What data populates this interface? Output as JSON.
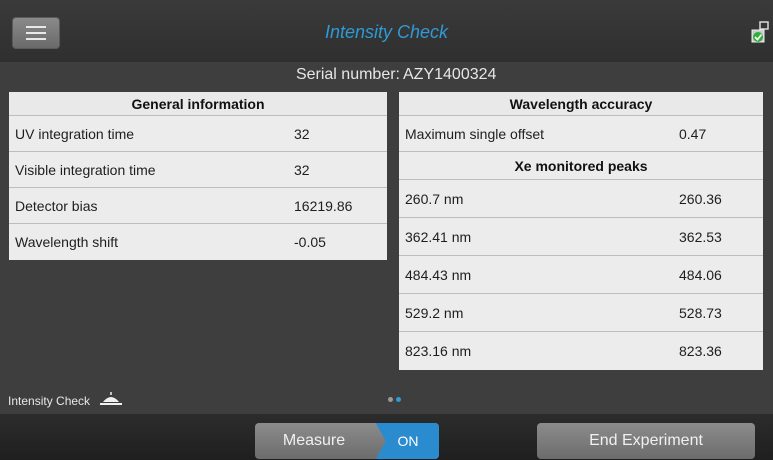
{
  "header": {
    "title": "Intensity Check",
    "menu_icon": "hamburger-menu-icon",
    "status_icon": "instrument-check-icon"
  },
  "serial": {
    "label": "Serial number:",
    "value": "AZY1400324"
  },
  "general_info": {
    "title": "General information",
    "rows": [
      {
        "label": "UV integration time",
        "value": "32"
      },
      {
        "label": "Visible integration time",
        "value": "32"
      },
      {
        "label": "Detector bias",
        "value": "16219.86"
      },
      {
        "label": "Wavelength shift",
        "value": "-0.05"
      }
    ]
  },
  "wavelength_accuracy": {
    "title": "Wavelength accuracy",
    "max_offset_label": "Maximum single offset",
    "max_offset_value": "0.47",
    "peaks_title": "Xe monitored peaks",
    "peaks": [
      {
        "label": "260.7 nm",
        "value": "260.36"
      },
      {
        "label": "362.41 nm",
        "value": "362.53"
      },
      {
        "label": "484.43 nm",
        "value": "484.06"
      },
      {
        "label": "529.2 nm",
        "value": "528.73"
      },
      {
        "label": "823.16 nm",
        "value": "823.36"
      }
    ]
  },
  "footer": {
    "mode_label": "Intensity Check",
    "mode_icon": "lamp-icon",
    "pager": {
      "pages": 2,
      "active": 2
    }
  },
  "bottom_bar": {
    "measure_label": "Measure",
    "measure_state": "ON",
    "end_label": "End Experiment"
  },
  "colors": {
    "accent": "#2e9ad6",
    "toggle_on": "#2a8ccf",
    "background": "#3e3e3e"
  }
}
